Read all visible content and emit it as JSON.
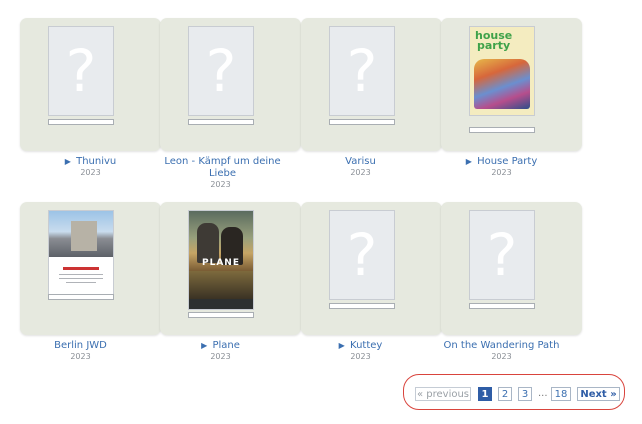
{
  "movies": [
    {
      "title": "Thunivu",
      "year": "2023",
      "play_marker": "▶"
    },
    {
      "title": "Leon - Kämpf um deine Liebe",
      "year": "2023"
    },
    {
      "title": "Varisu",
      "year": "2023"
    },
    {
      "title": "House Party",
      "year": "2023",
      "play_marker": "▶",
      "poster_text_1": "house",
      "poster_text_2": "party"
    },
    {
      "title": "Berlin JWD",
      "year": "2023"
    },
    {
      "title": "Plane",
      "year": "2023",
      "play_marker": "▶",
      "poster_text_1": "PLANE"
    },
    {
      "title": "Kuttey",
      "year": "2023",
      "play_marker": "▶"
    },
    {
      "title": "On the Wandering Path",
      "year": "2023"
    }
  ],
  "placeholder_glyph": "?",
  "pagination": {
    "previous": "« previous",
    "pages": [
      "1",
      "2",
      "3"
    ],
    "ellipsis": "...",
    "last": "18",
    "next": "Next »",
    "current": "1"
  },
  "colors": {
    "link": "#3b6fb0",
    "tile": "#e6e9df",
    "current_page": "#2f5da6",
    "highlight_outline": "#d9443d"
  }
}
